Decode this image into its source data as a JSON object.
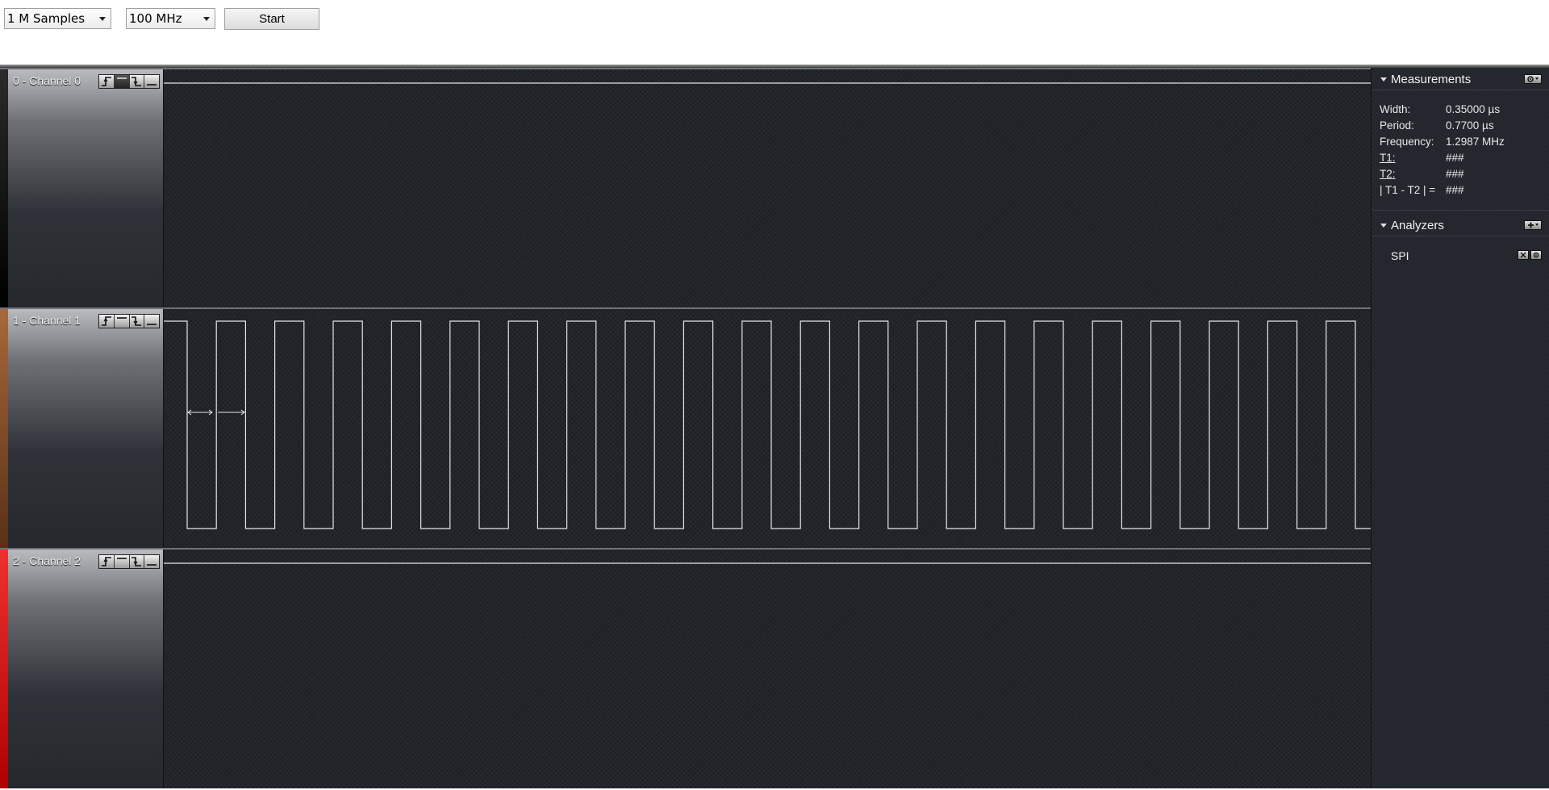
{
  "toolbar": {
    "samples": "1 M Samples",
    "rate": "100 MHz",
    "start_label": "Start"
  },
  "channels": [
    {
      "name": "0 - Channel 0",
      "color": "#000000",
      "signal": "idle-high"
    },
    {
      "name": "1 - Channel 1",
      "color": "#8b4a22",
      "signal": "clock"
    },
    {
      "name": "2 - Channel 2",
      "color": "#e01010",
      "signal": "idle-high"
    }
  ],
  "trigger_icons": [
    "rising-edge-icon",
    "high-level-icon",
    "falling-edge-icon",
    "low-level-icon"
  ],
  "measurements": {
    "title": "Measurements",
    "rows": [
      {
        "label": "Width:",
        "value": "0.35000 µs"
      },
      {
        "label": "Period:",
        "value": "0.7700 µs"
      },
      {
        "label": "Frequency:",
        "value": "1.2987 MHz"
      },
      {
        "label": "T1:",
        "value": "###"
      },
      {
        "label": "T2:",
        "value": "###"
      },
      {
        "label": "| T1 - T2 | =",
        "value": "###"
      }
    ]
  },
  "analyzers": {
    "title": "Analyzers",
    "items": [
      {
        "name": "SPI"
      }
    ]
  },
  "colors": {
    "plot_background": "#22252b",
    "trace": "#e6e6e6",
    "panel_text": "#f2f2f2"
  }
}
